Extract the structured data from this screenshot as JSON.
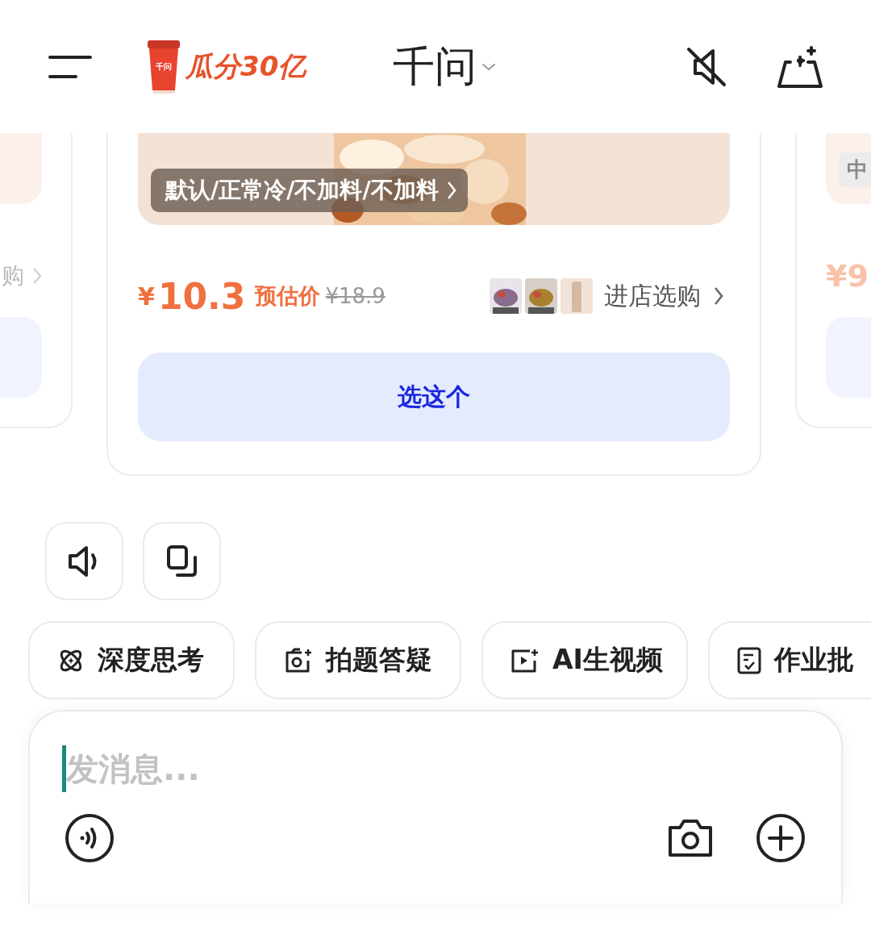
{
  "header": {
    "cup_label": "千问",
    "promo": "瓜分30亿",
    "title": "千问"
  },
  "carousel": {
    "left_card": {
      "link": "购"
    },
    "main_card": {
      "spec": "默认/正常冷/不加料/不加料",
      "currency": "¥",
      "price": "10.3",
      "price_note": "预估价",
      "original_price": "¥18.9",
      "shop_link": "进店选购",
      "select_button": "选这个"
    },
    "right_card": {
      "badge": "中",
      "price": "¥9"
    }
  },
  "chips": [
    {
      "kind": "think",
      "label": "深度思考"
    },
    {
      "label": "拍题答疑"
    },
    {
      "kind": "video",
      "label": "AI生视频"
    },
    {
      "kind": "homework",
      "label": "作业批"
    }
  ],
  "composer": {
    "placeholder": "发消息..."
  }
}
